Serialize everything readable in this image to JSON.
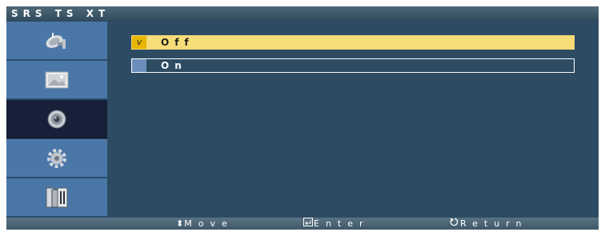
{
  "title": "SRS TS XT",
  "sidebar": {
    "items": [
      {
        "icon": "satellite-dish-icon",
        "active": false
      },
      {
        "icon": "picture-icon",
        "active": false
      },
      {
        "icon": "speaker-icon",
        "active": true
      },
      {
        "icon": "gear-icon",
        "active": false
      },
      {
        "icon": "multi-screen-icon",
        "active": false
      }
    ]
  },
  "options": [
    {
      "label": "Off",
      "selected": true,
      "mark": "v"
    },
    {
      "label": "On",
      "selected": false
    }
  ],
  "footer": {
    "move_label": "Move",
    "move_icon": "⬍",
    "enter_label": "Enter",
    "enter_icon": "enter-icon",
    "return_label": "Return",
    "return_icon": "return-icon"
  },
  "colors": {
    "background": "#2d4b63",
    "sidebar": "#4b77a8",
    "sidebar_active": "#172038",
    "highlight": "#f6dd78",
    "check": "#e8b500"
  }
}
